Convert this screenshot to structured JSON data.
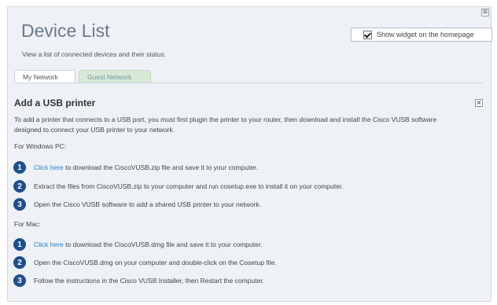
{
  "header": {
    "title": "Device List",
    "subtitle": "View a list of connected devices and their status.",
    "widget_label": "Show widget on the homepage",
    "widget_checked": true,
    "close_glyph": "⊠"
  },
  "tabs": [
    {
      "label": "My Network",
      "active": true
    },
    {
      "label": "Guest Network",
      "active": false
    }
  ],
  "section": {
    "title": "Add a USB printer",
    "description": "To add a printer that connects to a USB port, you must first plugin the printer to your router, then download and install the Cisco VUSB software designed to connect your USB printer to your network.",
    "windows_label": "For Windows PC:",
    "mac_label": "For Mac:",
    "windows_steps": [
      {
        "num": "1",
        "link": "Click here",
        "text": " to download the CiscoVUSB.zip file and save it to your computer."
      },
      {
        "num": "2",
        "link": "",
        "text": "Extract the files from CiscoVUSB.zip to your computer and run cosetup.exe to install it on your computer."
      },
      {
        "num": "3",
        "link": "",
        "text": "Open the Cisco VUSB software to add a shared USB printer to your network."
      }
    ],
    "mac_steps": [
      {
        "num": "1",
        "link": "Click here",
        "text": " to download the CiscoVUSB.dmg file and save it to your computer."
      },
      {
        "num": "2",
        "link": "",
        "text": "Open the CiscoVUSB.dmg on your computer and double-click on the Cosetup file."
      },
      {
        "num": "3",
        "link": "",
        "text": "Follow the instructions in the Cisco VUSB Installer, then Restart the computer."
      }
    ]
  },
  "colors": {
    "accent": "#1f4e8c",
    "link": "#2a7fc1",
    "panel_bg": "#eef1f5"
  }
}
